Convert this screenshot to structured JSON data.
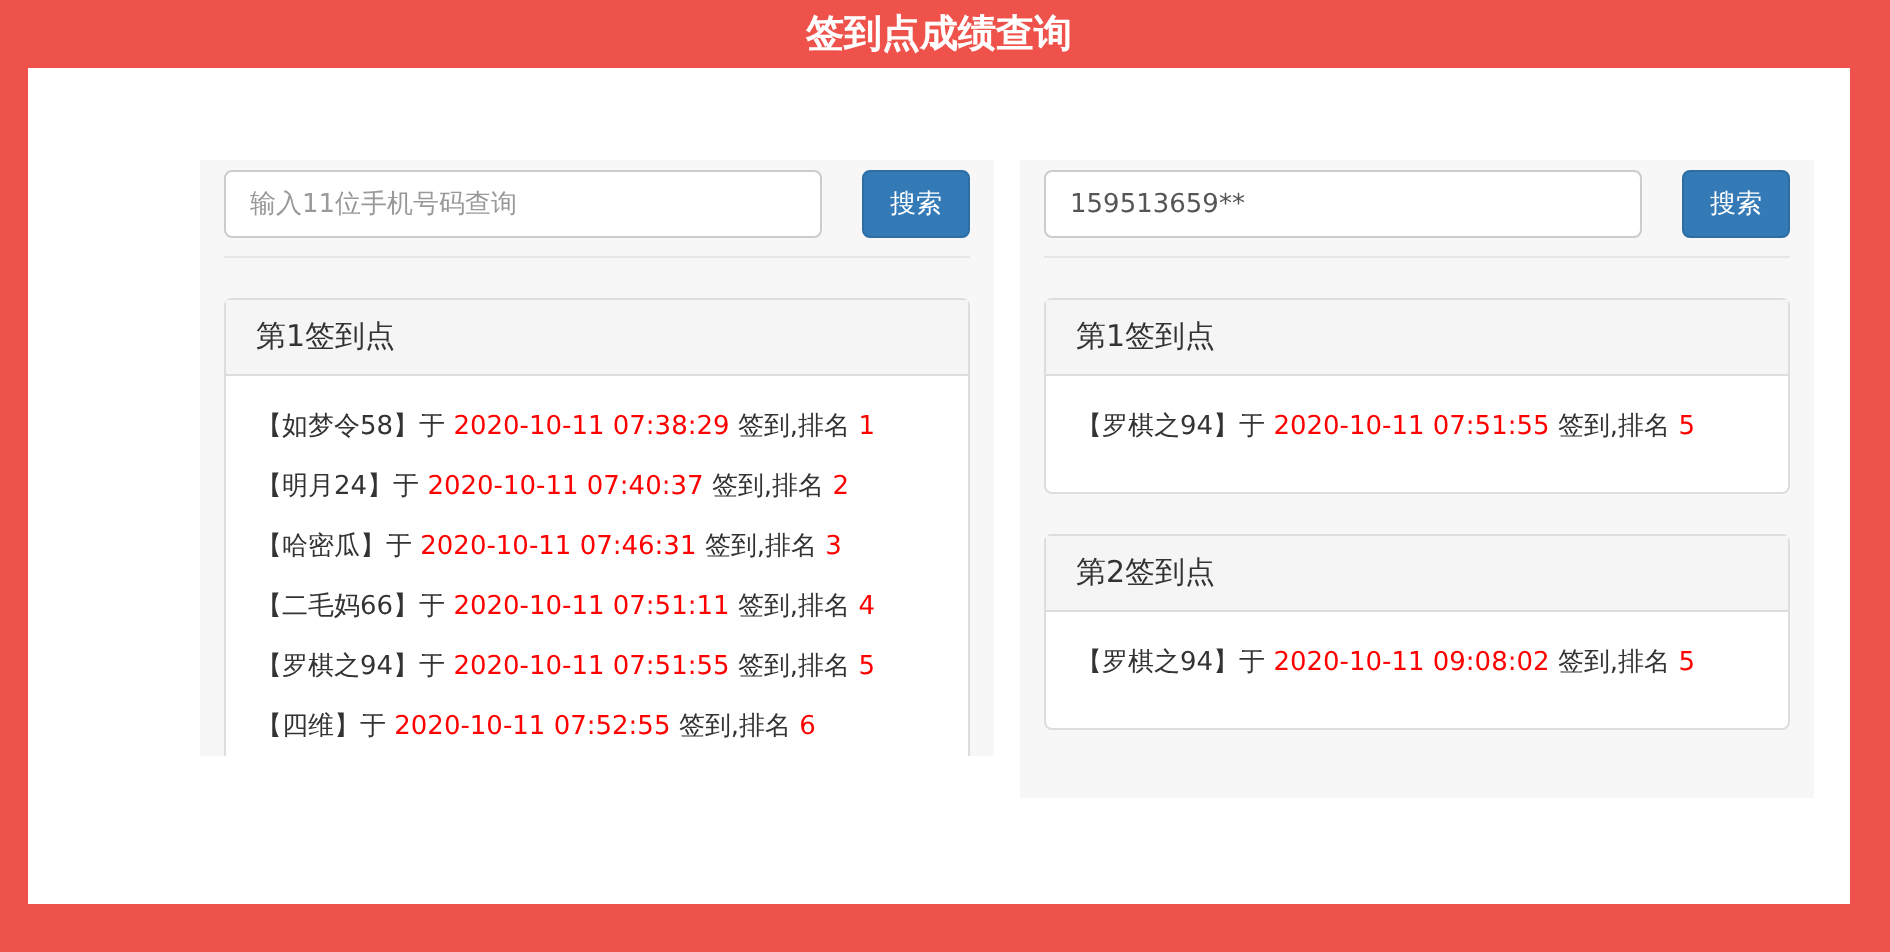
{
  "title": "签到点成绩查询",
  "panels": [
    {
      "search": {
        "placeholder": "输入11位手机号码查询"
      },
      "button": "搜索",
      "clipped": true,
      "sites": [
        {
          "title": "第1签到点",
          "records": [
            {
              "name": "【如梦令58】",
              "at": "于",
              "time": "2020-10-11 07:38:29",
              "action": "签到,排名",
              "rank": "1"
            },
            {
              "name": "【明月24】",
              "at": "于",
              "time": "2020-10-11 07:40:37",
              "action": "签到,排名",
              "rank": "2"
            },
            {
              "name": "【哈密瓜】",
              "at": "于",
              "time": "2020-10-11 07:46:31",
              "action": "签到,排名",
              "rank": "3"
            },
            {
              "name": "【二毛妈66】",
              "at": "于",
              "time": "2020-10-11 07:51:11",
              "action": "签到,排名",
              "rank": "4"
            },
            {
              "name": "【罗棋之94】",
              "at": "于",
              "time": "2020-10-11 07:51:55",
              "action": "签到,排名",
              "rank": "5"
            },
            {
              "name": "【四维】",
              "at": "于",
              "time": "2020-10-11 07:52:55",
              "action": "签到,排名",
              "rank": "6"
            }
          ]
        }
      ]
    },
    {
      "search": {
        "value": "159513659**"
      },
      "button": "搜索",
      "clipped": false,
      "sites": [
        {
          "title": "第1签到点",
          "records": [
            {
              "name": "【罗棋之94】",
              "at": "于",
              "time": "2020-10-11 07:51:55",
              "action": "签到,排名",
              "rank": "5"
            }
          ]
        },
        {
          "title": "第2签到点",
          "records": [
            {
              "name": "【罗棋之94】",
              "at": "于",
              "time": "2020-10-11 09:08:02",
              "action": "签到,排名",
              "rank": "5"
            }
          ]
        }
      ]
    }
  ]
}
